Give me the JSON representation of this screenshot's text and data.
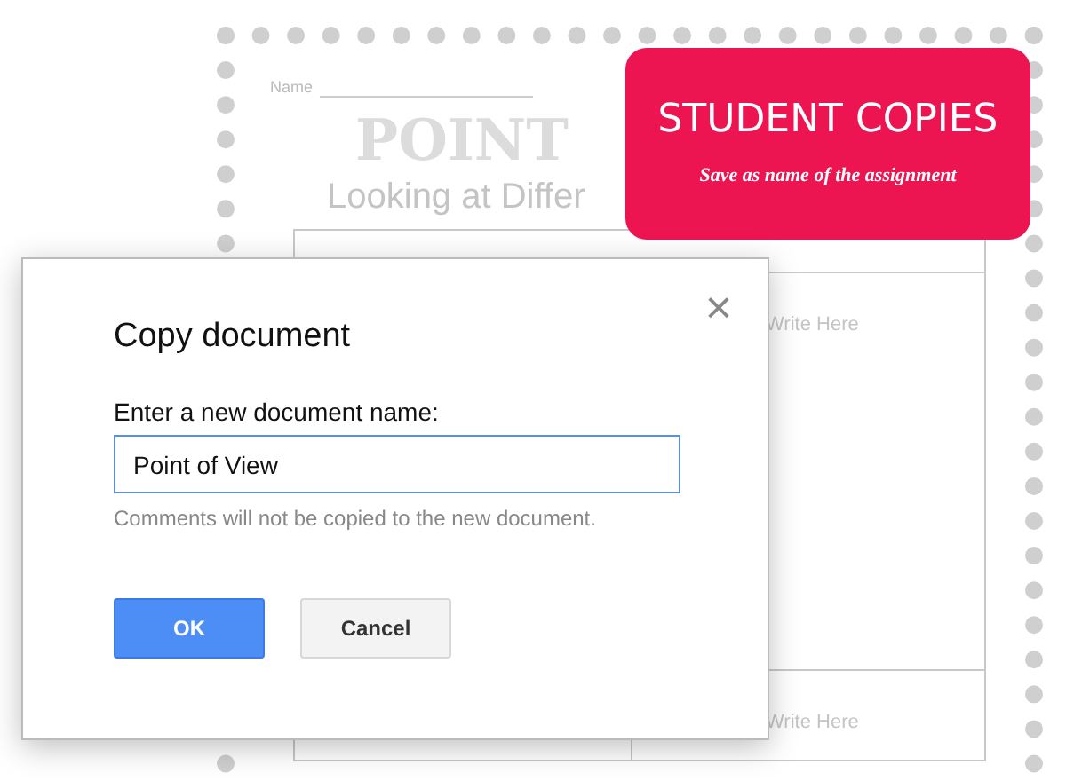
{
  "worksheet": {
    "name_label": "Name",
    "title": "POINT",
    "subtitle": "Looking at Differ",
    "cells": [
      "Write Here",
      "Write Here"
    ]
  },
  "banner": {
    "title": "STUDENT COPIES",
    "subtitle": "Save as name of the assignment"
  },
  "dialog": {
    "title": "Copy document",
    "label": "Enter a new document name:",
    "value": "Point of View",
    "hint": "Comments will not be copied to the new document.",
    "close": "×",
    "buttons": [
      {
        "label": "OK",
        "kind": "primary"
      },
      {
        "label": "Cancel",
        "kind": "secondary"
      }
    ]
  }
}
